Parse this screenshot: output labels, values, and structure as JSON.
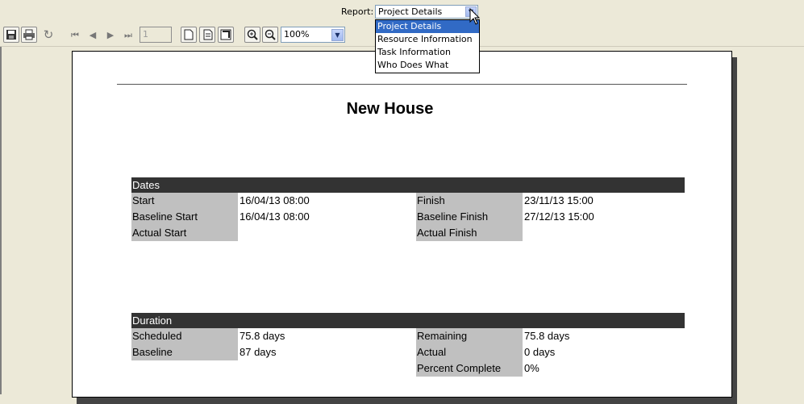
{
  "toolbar": {
    "report_label": "Report:",
    "report_selected": "Project Details",
    "page_number": "1",
    "zoom": "100%",
    "icons": [
      "save-icon",
      "print-icon",
      "refresh-icon",
      "first-page-icon",
      "previous-page-icon",
      "next-page-icon",
      "last-page-icon",
      "single-page-icon",
      "multi-page-icon",
      "full-page-icon",
      "zoom-in-icon",
      "zoom-out-icon"
    ]
  },
  "report_dropdown": {
    "options": [
      "Project Details",
      "Resource Information",
      "Task Information",
      "Who Does What"
    ],
    "highlighted": "Project Details"
  },
  "report": {
    "title": "New House",
    "dates": {
      "header": "Dates",
      "rows": [
        {
          "label": "Start",
          "value": "16/04/13 08:00",
          "label2": "Finish",
          "value2": "23/11/13 15:00"
        },
        {
          "label": "Baseline Start",
          "value": "16/04/13 08:00",
          "label2": "Baseline Finish",
          "value2": "27/12/13 15:00"
        },
        {
          "label": "Actual Start",
          "value": "",
          "label2": "Actual Finish",
          "value2": ""
        }
      ]
    },
    "duration": {
      "header": "Duration",
      "rows": [
        {
          "label": "Scheduled",
          "value": "75.8 days",
          "label2": "Remaining",
          "value2": "75.8 days"
        },
        {
          "label": "Baseline",
          "value": "87 days",
          "label2": "Actual",
          "value2": "0 days"
        },
        {
          "label": "",
          "value": "",
          "label2": "Percent Complete",
          "value2": "0%"
        }
      ]
    }
  }
}
